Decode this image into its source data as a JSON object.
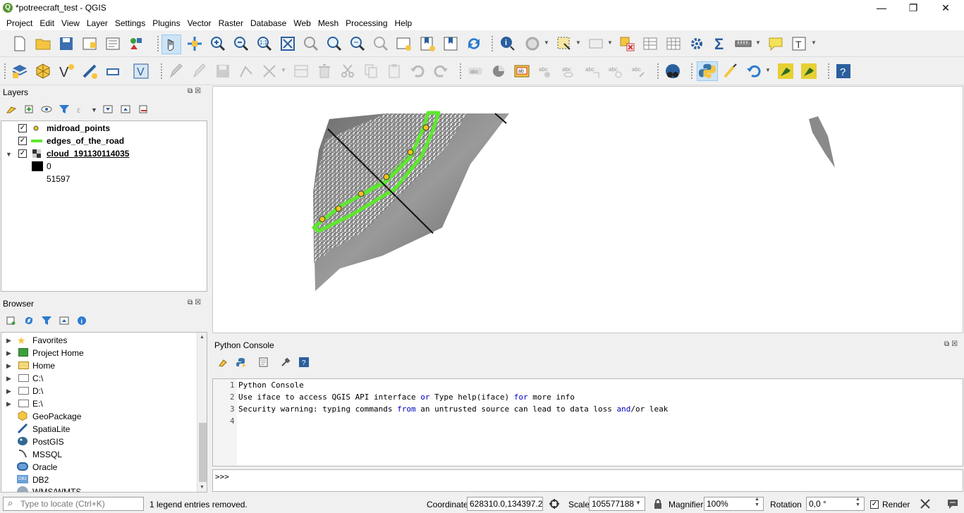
{
  "window": {
    "title": "*potreecraft_test - QGIS",
    "logo": "Q",
    "min": "—",
    "max": "❐",
    "close": "✕"
  },
  "menu": [
    "Project",
    "Edit",
    "View",
    "Layer",
    "Settings",
    "Plugins",
    "Vector",
    "Raster",
    "Database",
    "Web",
    "Mesh",
    "Processing",
    "Help"
  ],
  "layers_panel": {
    "title": "Layers",
    "items": [
      {
        "name": "midroad_points",
        "checked": true
      },
      {
        "name": "edges_of_the_road",
        "checked": true
      },
      {
        "name": "cloud_191130114035",
        "checked": true
      }
    ],
    "legend": {
      "min": "0",
      "max": "51597"
    }
  },
  "browser_panel": {
    "title": "Browser",
    "items": [
      "Favorites",
      "Project Home",
      "Home",
      "C:\\",
      "D:\\",
      "E:\\",
      "GeoPackage",
      "SpatiaLite",
      "PostGIS",
      "MSSQL",
      "Oracle",
      "DB2",
      "WMS/WMTS"
    ]
  },
  "python_console": {
    "title": "Python Console",
    "line_numbers": [
      "1",
      "2",
      "3",
      "4"
    ],
    "lines": [
      {
        "a": "Python Console",
        "k1": "",
        "b": "",
        "k2": "",
        "c": ""
      },
      {
        "a": "Use iface to access QGIS API interface ",
        "k1": "or",
        "b": " Type help(iface) ",
        "k2": "for",
        "c": " more info"
      },
      {
        "a": "Security warning: typing commands ",
        "k1": "from",
        "b": " an untrusted source can lead to data loss ",
        "k2": "and",
        "c": "/or leak"
      }
    ],
    "prompt": ">>>"
  },
  "status": {
    "locator_placeholder": "Type to locate (Ctrl+K)",
    "message": "1 legend entries removed.",
    "coordinate_label": "Coordinate",
    "coordinate": "628310.0,134397.2",
    "scale_label": "Scale",
    "scale": "105577188",
    "magnifier_label": "Magnifier",
    "magnifier": "100%",
    "rotation_label": "Rotation",
    "rotation": "0,0 °",
    "render_label": "Render"
  },
  "colors": {
    "road_edge": "#5ee82e",
    "midpoint": "#f0c419",
    "selected_tool": "#cce4f7"
  }
}
